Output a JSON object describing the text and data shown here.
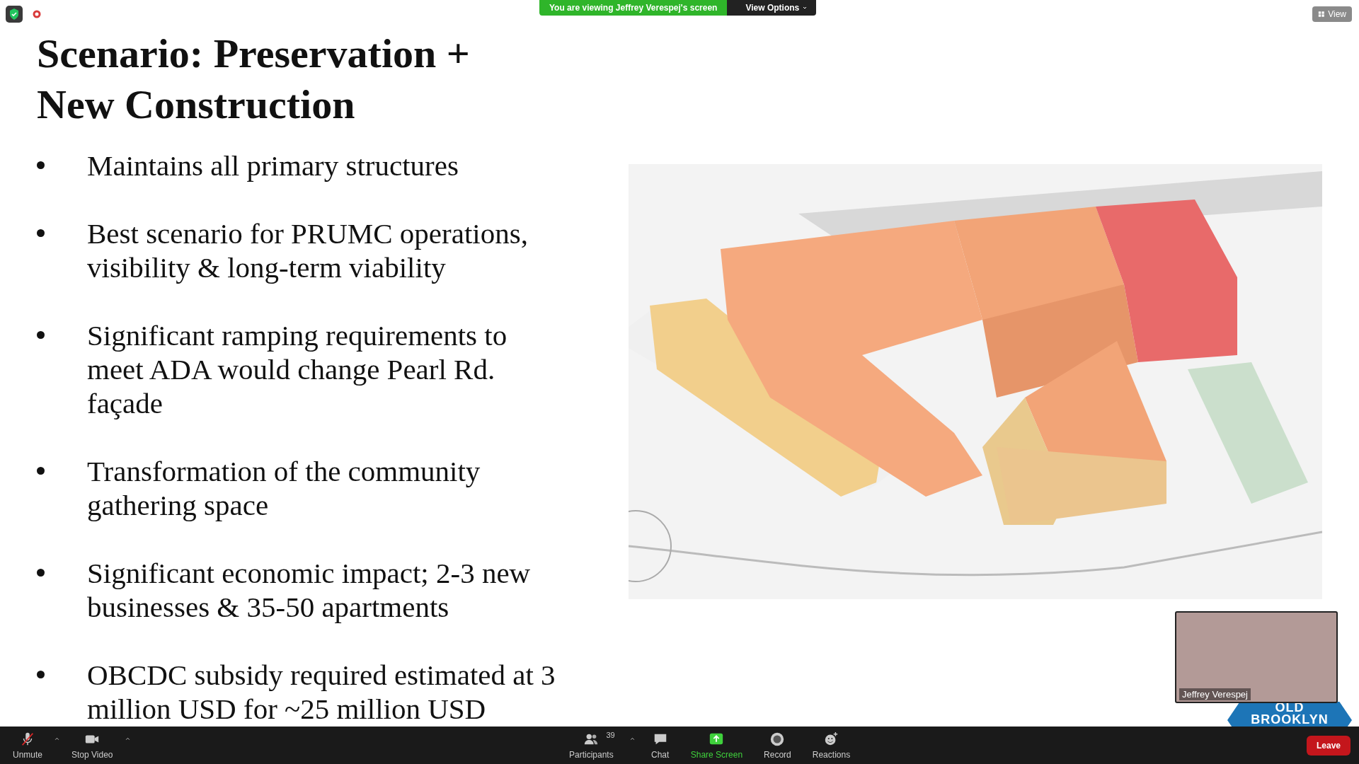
{
  "banner": {
    "text": "You are viewing Jeffrey Verespej's screen",
    "button": "View Options"
  },
  "view_button": {
    "label": "View"
  },
  "slide": {
    "title": "Scenario: Preservation + New Construction",
    "bullets": [
      "Maintains all primary structures",
      "Best scenario for PRUMC operations, visibility & long-term viability",
      "Significant ramping requirements to meet ADA would change Pearl Rd. façade",
      "Transformation of the community gathering space",
      "Significant economic impact; 2-3 new businesses & 35-50 apartments",
      "OBCDC subsidy required estimated at 3 million USD for ~25 million USD"
    ]
  },
  "participant_video": {
    "name": "Jeffrey Verespej"
  },
  "logo": {
    "lines": [
      "OLD",
      "BROOKLYN"
    ]
  },
  "toolbar": {
    "left": [
      {
        "kind": "mic",
        "label": "Unmute",
        "muted": true
      },
      {
        "kind": "camera",
        "label": "Stop Video",
        "muted": false
      }
    ],
    "center": [
      {
        "kind": "participants",
        "label": "Participants",
        "count": "39",
        "highlighted": false
      },
      {
        "kind": "chat",
        "label": "Chat",
        "highlighted": false
      },
      {
        "kind": "share",
        "label": "Share Screen",
        "highlighted": true
      },
      {
        "kind": "record",
        "label": "Record",
        "highlighted": false
      },
      {
        "kind": "reactions",
        "label": "Reactions",
        "highlighted": false
      }
    ],
    "leave": "Leave"
  }
}
